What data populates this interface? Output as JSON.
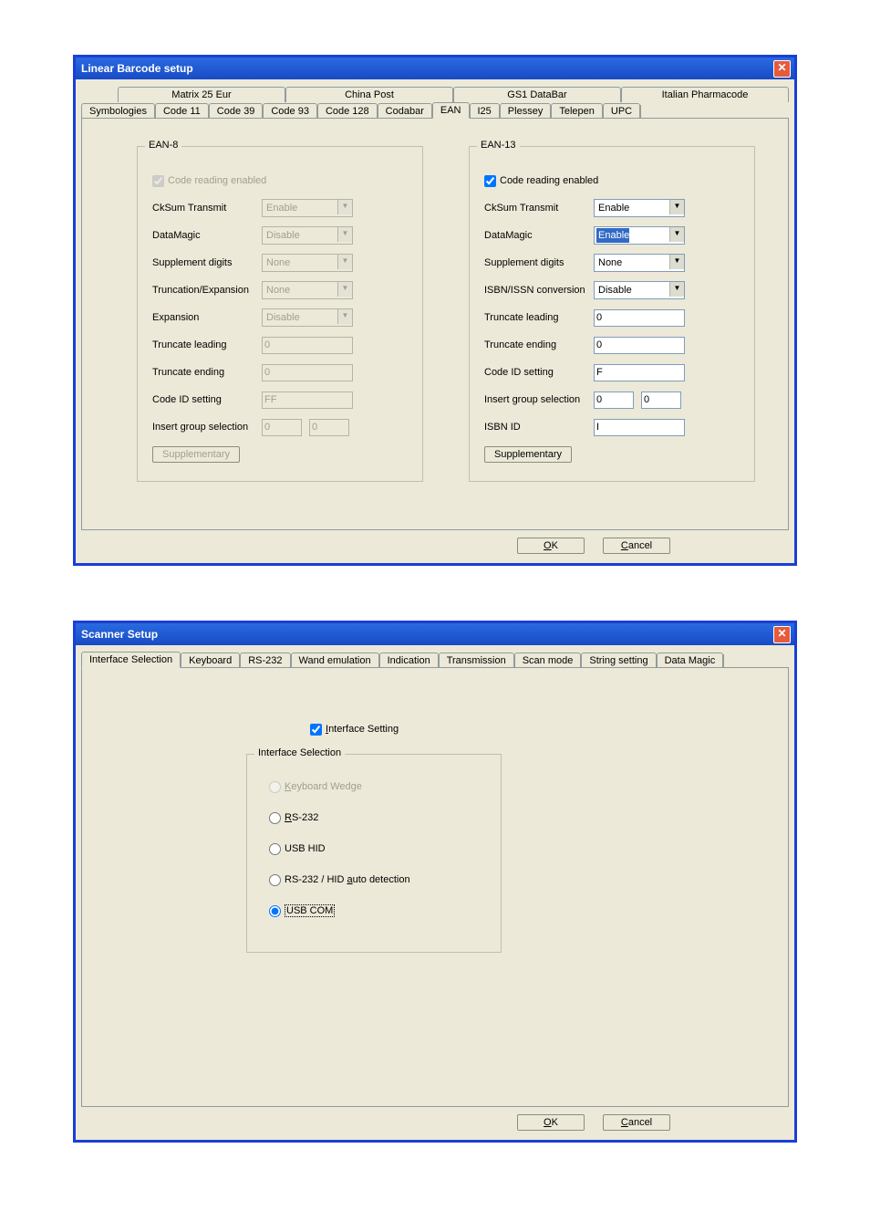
{
  "win1": {
    "title": "Linear Barcode setup",
    "tabs_row1": [
      "Matrix 25 Eur",
      "China Post",
      "GS1 DataBar",
      "Italian Pharmacode"
    ],
    "tabs_row2": [
      "Symbologies",
      "Code 11",
      "Code 39",
      "Code 93",
      "Code 128",
      "Codabar",
      "EAN",
      "I25",
      "Plessey",
      "Telepen",
      "UPC"
    ],
    "active_tab": "EAN",
    "ean8": {
      "legend": "EAN-8",
      "code_reading_label": "Code reading enabled",
      "code_reading_checked": true,
      "code_reading_disabled": true,
      "rows": [
        {
          "label": "CkSum Transmit",
          "type": "combo",
          "value": "Enable",
          "disabled": true
        },
        {
          "label": "DataMagic",
          "type": "combo",
          "value": "Disable",
          "disabled": true
        },
        {
          "label": "Supplement digits",
          "type": "combo",
          "value": "None",
          "disabled": true
        },
        {
          "label": "Truncation/Expansion",
          "type": "combo",
          "value": "None",
          "disabled": true
        },
        {
          "label": "Expansion",
          "type": "combo",
          "value": "Disable",
          "disabled": true
        },
        {
          "label": "Truncate leading",
          "type": "text",
          "value": "0",
          "disabled": true
        },
        {
          "label": "Truncate ending",
          "type": "text",
          "value": "0",
          "disabled": true
        },
        {
          "label": "Code ID setting",
          "type": "text",
          "value": "FF",
          "disabled": true
        },
        {
          "label": "Insert group selection",
          "type": "pair",
          "value": "0",
          "value2": "0",
          "disabled": true
        }
      ],
      "supp_btn": "Supplementary"
    },
    "ean13": {
      "legend": "EAN-13",
      "code_reading_label": "Code reading enabled",
      "code_reading_checked": true,
      "code_reading_disabled": false,
      "rows": [
        {
          "label": "CkSum Transmit",
          "type": "combo",
          "value": "Enable",
          "disabled": false
        },
        {
          "label": "DataMagic",
          "type": "combo",
          "value": "Enable",
          "disabled": false,
          "highlight": true
        },
        {
          "label": "Supplement digits",
          "type": "combo",
          "value": "None",
          "disabled": false
        },
        {
          "label": "ISBN/ISSN conversion",
          "type": "combo",
          "value": "Disable",
          "disabled": false
        },
        {
          "label": "Truncate leading",
          "type": "text",
          "value": "0",
          "disabled": false
        },
        {
          "label": "Truncate ending",
          "type": "text",
          "value": "0",
          "disabled": false
        },
        {
          "label": "Code ID setting",
          "type": "text",
          "value": "F",
          "disabled": false
        },
        {
          "label": "Insert group selection",
          "type": "pair",
          "value": "0",
          "value2": "0",
          "disabled": false
        },
        {
          "label": "ISBN ID",
          "type": "text",
          "value": "I",
          "disabled": false
        }
      ],
      "supp_btn": "Supplementary"
    },
    "ok_label": "OK",
    "cancel_label": "Cancel"
  },
  "win2": {
    "title": "Scanner Setup",
    "tabs": [
      "Interface Selection",
      "Keyboard",
      "RS-232",
      "Wand emulation",
      "Indication",
      "Transmission",
      "Scan mode",
      "String setting",
      "Data Magic"
    ],
    "active_tab": "Interface Selection",
    "interface_setting_label": "Interface Setting",
    "interface_setting_checked": true,
    "gbox_legend": "Interface Selection",
    "radios": [
      {
        "label": "Keyboard Wedge",
        "underline": "K",
        "checked": false,
        "disabled": true
      },
      {
        "label": "RS-232",
        "underline": "R",
        "checked": false,
        "disabled": false
      },
      {
        "label": "USB HID",
        "underline": "",
        "checked": false,
        "disabled": false
      },
      {
        "label": "RS-232 / HID auto detection",
        "underline": "a",
        "checked": false,
        "disabled": false
      },
      {
        "label": "USB COM",
        "underline": "",
        "checked": true,
        "disabled": false,
        "focus": true
      }
    ],
    "ok_label": "OK",
    "cancel_label": "Cancel"
  }
}
